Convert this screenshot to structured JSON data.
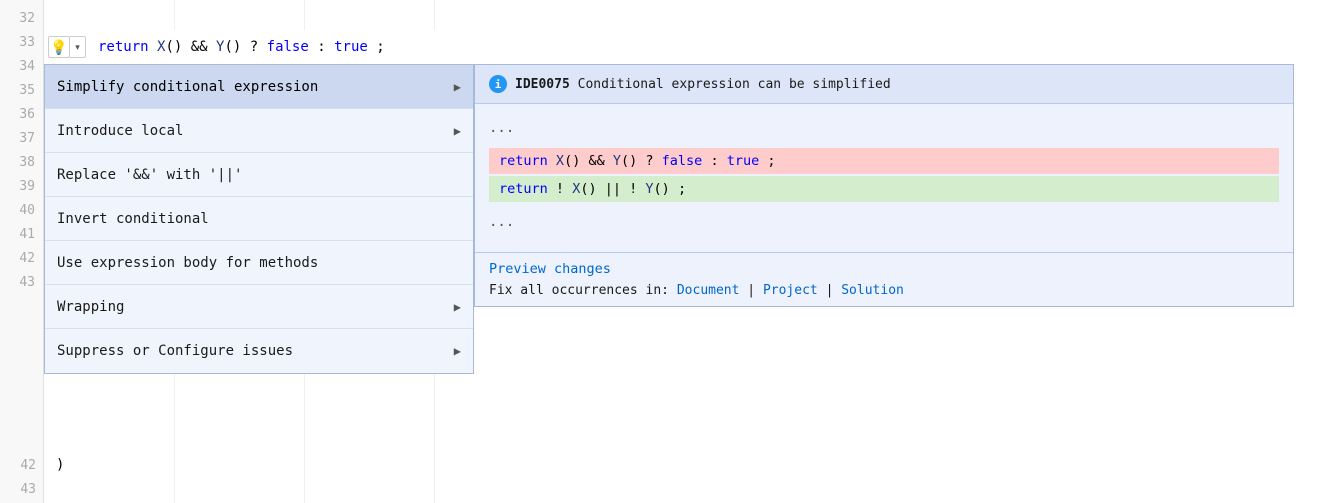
{
  "editor": {
    "line_numbers": [
      "32",
      "33",
      "34",
      "35",
      "36",
      "37",
      "38",
      "39",
      "40",
      "41",
      "42",
      "43"
    ],
    "code_line_33": "return X() && Y() ? false : true;",
    "bulb_icon": "💡",
    "dropdown_arrow": "▾"
  },
  "context_menu": {
    "items": [
      {
        "id": "simplify",
        "label": "Simplify conditional expression",
        "has_arrow": true,
        "selected": true
      },
      {
        "id": "introduce-local",
        "label": "Introduce local",
        "has_arrow": true,
        "selected": false
      },
      {
        "id": "replace-and",
        "label": "Replace '&&' with '||'",
        "has_arrow": false,
        "selected": false
      },
      {
        "id": "invert-conditional",
        "label": "Invert conditional",
        "has_arrow": false,
        "selected": false
      },
      {
        "id": "expression-body",
        "label": "Use expression body for methods",
        "has_arrow": false,
        "selected": false
      },
      {
        "id": "wrapping",
        "label": "Wrapping",
        "has_arrow": true,
        "selected": false
      },
      {
        "id": "suppress",
        "label": "Suppress or Configure issues",
        "has_arrow": true,
        "selected": false
      }
    ]
  },
  "preview_panel": {
    "info_icon": "i",
    "diagnostic_id": "IDE0075",
    "diagnostic_msg": "Conditional expression can be simplified",
    "ellipsis_top": "...",
    "code_removed": "return X() && Y() ? false : true;",
    "code_added": "return !X() || !Y();",
    "ellipsis_bottom": "...",
    "preview_changes_label": "Preview changes",
    "fix_all_prefix": "Fix all occurrences in:",
    "fix_document": "Document",
    "fix_separator1": " | ",
    "fix_project": "Project",
    "fix_separator2": " | ",
    "fix_solution": "Solution"
  },
  "bottom_code": {
    "line_42_code": ")",
    "line_43_code": ""
  }
}
